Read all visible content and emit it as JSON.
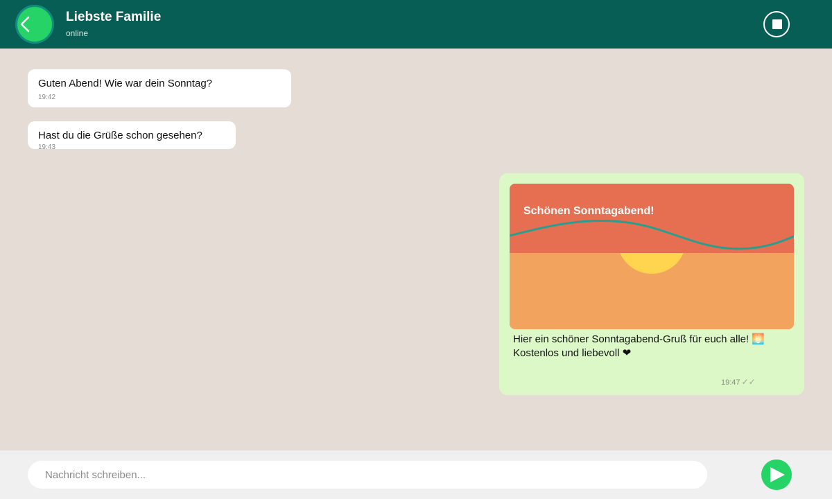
{
  "header": {
    "title": "Liebste Familie",
    "status": "online",
    "back_icon": "chevron-left-icon",
    "stop_icon": "stop-icon"
  },
  "messages": [
    {
      "direction": "incoming",
      "text": "Guten Abend! Wie war dein Sonntag?",
      "time": "19:42"
    },
    {
      "direction": "incoming",
      "text": "Hast du die Grüße schon gesehen?",
      "time": "19:43"
    },
    {
      "direction": "outgoing",
      "image_title": "Schönen Sonntagabend!",
      "caption_line1": "Hier ein schöner Sonntagabend-Gruß für euch alle! 🌅",
      "caption_line2": "Kostenlos und liebevoll ❤",
      "time": "19:47",
      "ticks": "✓✓"
    }
  ],
  "composer": {
    "placeholder": "Nachricht schreiben...",
    "send_icon": "send-icon"
  },
  "colors": {
    "header": "#075e54",
    "accent": "#25d366",
    "chat_bg": "#e5ddd5",
    "outgoing_bubble": "#dcf8c6",
    "card_sky": "#e76f51",
    "card_ground": "#f2a45f",
    "card_sun": "#ffd54f",
    "card_wave": "#2a9d8f"
  }
}
